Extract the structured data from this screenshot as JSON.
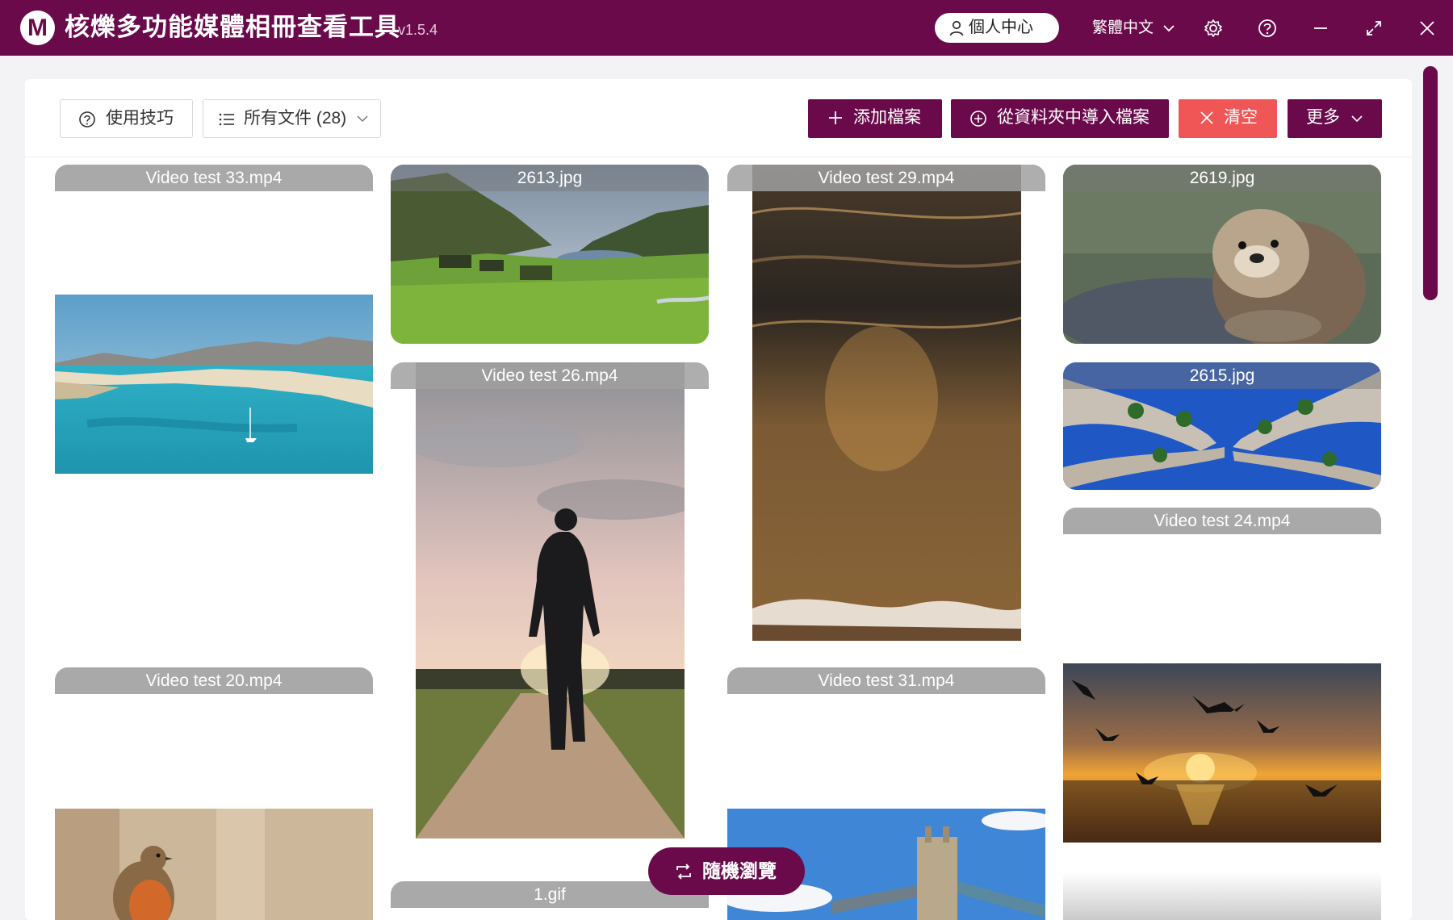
{
  "app": {
    "logo_letter": "M",
    "title": "核爍多功能媒體相冊查看工具",
    "version": "- v1.5.4"
  },
  "header": {
    "user_center_label": "個人中心",
    "language_label": "繁體中文"
  },
  "icons": {
    "user": "user-icon",
    "lang_dropdown": "chevron-down-icon",
    "settings": "gear-icon",
    "help": "help-icon",
    "minimize": "minimize-icon",
    "maximize": "maximize-icon",
    "close": "close-icon"
  },
  "toolbar": {
    "tips_label": "使用技巧",
    "filter_label": "所有文件 (28)",
    "add_label": "添加檔案",
    "import_label": "從資料夾中導入檔案",
    "clear_label": "清空",
    "more_label": "更多"
  },
  "colors": {
    "brand": "#6b0a4b",
    "danger": "#f05656",
    "caption": "#a0a0a0"
  },
  "media": [
    {
      "name": "Video test 33.mp4",
      "type": "video"
    },
    {
      "name": "2613.jpg",
      "type": "image",
      "subject": "green valley with turf houses and lake"
    },
    {
      "name": "Video test 29.mp4",
      "type": "video",
      "subject": "sea waves at sunset"
    },
    {
      "name": "2619.jpg",
      "type": "image",
      "subject": "sea otter"
    },
    {
      "name": "Video test 26.mp4",
      "type": "video",
      "subject": "man walking on path at sunset"
    },
    {
      "name": "2615.jpg",
      "type": "image",
      "subject": "trees seen from below against blue sky"
    },
    {
      "name": "Video test 24.mp4",
      "type": "video"
    },
    {
      "name": "Video test 20.mp4",
      "type": "video"
    },
    {
      "name": "Video test 31.mp4",
      "type": "video",
      "subject": "Tower Bridge"
    },
    {
      "name": "1.gif",
      "type": "gif"
    }
  ],
  "random_browse_label": "隨機瀏覽"
}
